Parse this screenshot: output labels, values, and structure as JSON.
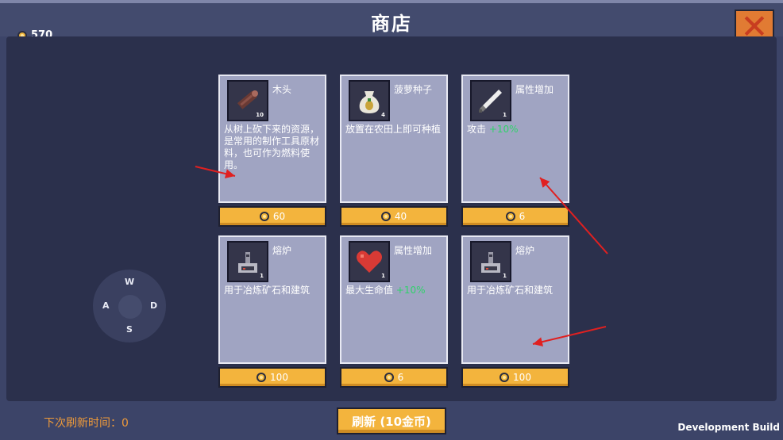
{
  "header": {
    "title": "商店",
    "coins": "570"
  },
  "cards": [
    {
      "name": "木头",
      "count": "10",
      "desc": "从树上砍下来的资源，是常用的制作工具原材料，也可作为燃料使用。",
      "price": "60",
      "icon": "log-icon"
    },
    {
      "name": "菠萝种子",
      "count": "4",
      "desc": "放置在农田上即可种植",
      "price": "40",
      "icon": "seed-bag-icon"
    },
    {
      "name": "属性增加",
      "count": "1",
      "desc": "攻击",
      "bonus": "+10%",
      "price": "6",
      "icon": "sword-icon"
    },
    {
      "name": "熔炉",
      "count": "1",
      "desc": "用于冶炼矿石和建筑",
      "price": "100",
      "icon": "furnace-icon"
    },
    {
      "name": "属性增加",
      "count": "1",
      "desc": "最大生命值",
      "bonus": "+10%",
      "price": "6",
      "icon": "heart-icon"
    },
    {
      "name": "熔炉",
      "count": "1",
      "desc": "用于冶炼矿石和建筑",
      "price": "100",
      "icon": "furnace-icon"
    }
  ],
  "joystick": {
    "up": "W",
    "left": "A",
    "right": "D",
    "down": "S"
  },
  "footer": {
    "refresh_timer": "下次刷新时间：0",
    "refresh_button": "刷新 (10金币)",
    "build": "Development Build"
  },
  "colors": {
    "price_button": "#f3b43d",
    "card_bg": "#a0a4c2",
    "panel_bg": "#2b304c",
    "bonus": "#2fd36a",
    "annotation_arrow": "#e02020"
  }
}
